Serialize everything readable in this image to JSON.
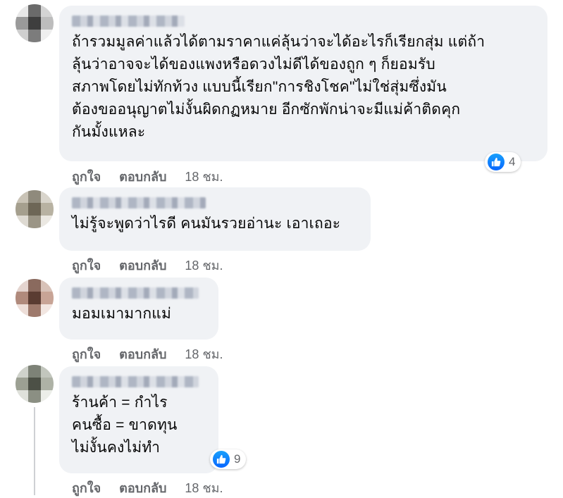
{
  "colors": {
    "bubble": "#f0f2f5",
    "meta": "#65676b",
    "like": "#0866ff"
  },
  "comments": [
    {
      "text": "ถ้ารวมมูลค่าแล้วได้ตามราคาแค่ลุ้นว่าจะได้อะไรก็เรียกสุ่ม แต่ถ้า\nลุ้นว่าอาจจะได้ของแพงหรือดวงไม่ดีได้ของถูก ๆ ก็ยอมรับ\nสภาพโดยไม่ทักท้วง แบบนี้เรียก\"การชิงโชค\"ไม่ใช่สุ่มซึ่งมัน\nต้องขออนุญาตไม่งั้นผิดกฏหมาย อีกซักพักน่าจะมีแม่ค้าติดคุก\nกันมั้งแหละ",
      "like": "ถูกใจ",
      "reply": "ตอบกลับ",
      "time": "18 ชม.",
      "reaction_icon": "like-icon",
      "reaction_count": "4"
    },
    {
      "text": "ไม่รู้จะพูดว่าไรดี คนมันรวยอ่านะ เอาเถอะ",
      "like": "ถูกใจ",
      "reply": "ตอบกลับ",
      "time": "18 ชม."
    },
    {
      "text": "มอมเมามากแม่",
      "like": "ถูกใจ",
      "reply": "ตอบกลับ",
      "time": "18 ชม."
    },
    {
      "text": "ร้านค้า = กำไร\nคนซื้อ = ขาดทุน\nไม่งั้นคงไม่ทำ",
      "like": "ถูกใจ",
      "reply": "ตอบกลับ",
      "time": "18 ชม.",
      "reaction_icon": "like-icon",
      "reaction_count": "9"
    }
  ]
}
